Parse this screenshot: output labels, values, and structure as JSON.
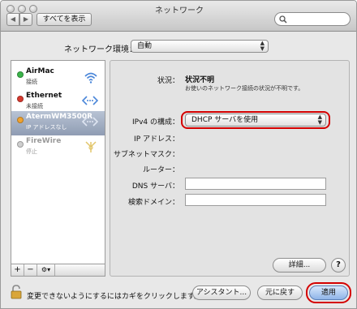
{
  "window": {
    "title": "ネットワーク"
  },
  "toolbar": {
    "back_icon": "chevron-left-icon",
    "forward_icon": "chevron-right-icon",
    "show_all_label": "すべてを表示",
    "search_placeholder": ""
  },
  "location": {
    "label": "ネットワーク環境：",
    "value": "自動"
  },
  "services": [
    {
      "name": "AirMac",
      "status": "接続",
      "dot_color": "#3bb54a",
      "icon": "wifi-icon"
    },
    {
      "name": "Ethernet",
      "status": "未接続",
      "dot_color": "#d63a2f",
      "icon": "ethernet-icon"
    },
    {
      "name": "AtermWM3500R",
      "status": "IP アドレスなし",
      "dot_color": "#f0a22e",
      "icon": "ethernet-icon",
      "selected": true
    },
    {
      "name": "FireWire",
      "status": "停止",
      "dot_color": "#cfcfcf",
      "icon": "firewire-icon"
    }
  ],
  "sidebar_tools": {
    "add": "+",
    "remove": "−",
    "gear": "⚙▾"
  },
  "detail": {
    "status_label": "状況：",
    "status_value": "状況不明",
    "status_desc": "お使いのネットワーク接続の状況が不明です。",
    "ipv4_label": "IPv4 の構成：",
    "ipv4_value": "DHCP サーバを使用",
    "ip_label": "IP アドレス：",
    "subnet_label": "サブネットマスク：",
    "router_label": "ルーター：",
    "dns_label": "DNS サーバ：",
    "search_domain_label": "検索ドメイン：",
    "advanced_button": "詳細...",
    "help_button": "?"
  },
  "footer": {
    "lock_text": "変更できないようにするにはカギをクリックします。",
    "assistant_button": "アシスタント...",
    "revert_button": "元に戻す",
    "apply_button": "適用"
  },
  "colors": {
    "highlight": "#d40000",
    "selection": "#8f9cb3"
  }
}
